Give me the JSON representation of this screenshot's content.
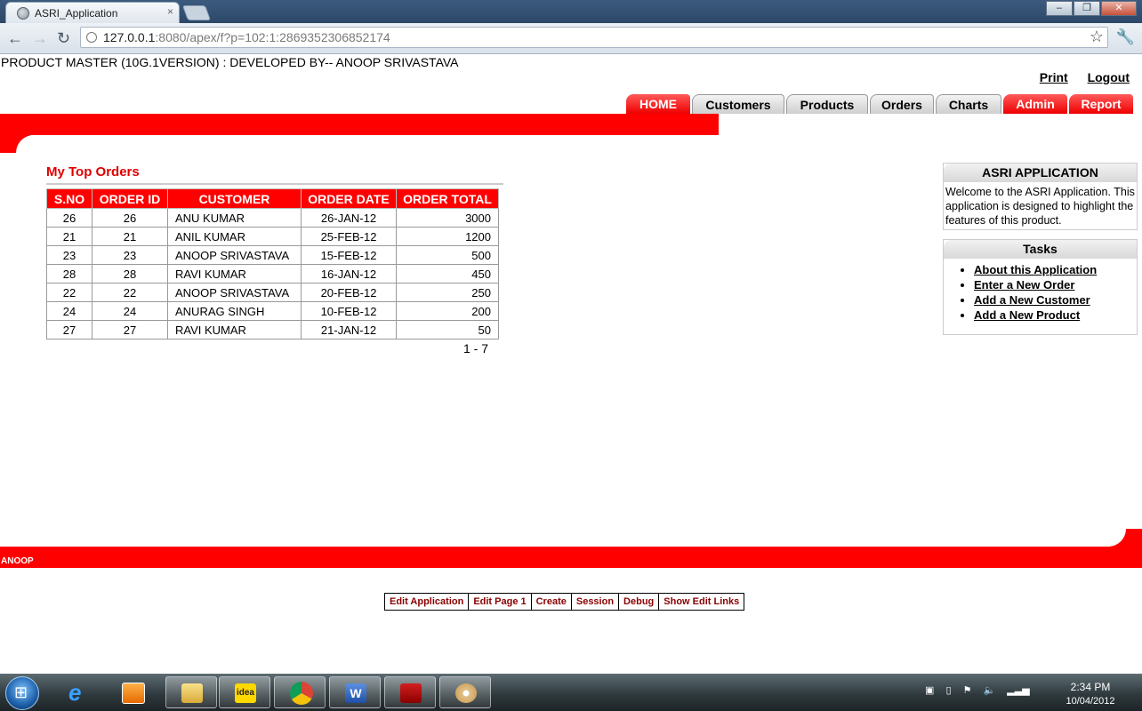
{
  "browser": {
    "tab_title": "ASRI_Application",
    "url_host": "127.0.0.1",
    "url_rest": ":8080/apex/f?p=102:1:2869352306852174"
  },
  "app": {
    "title": "PRODUCT MASTER (10G.1VERSION) : DEVELOPED BY-- ANOOP SRIVASTAVA",
    "links": [
      "Print",
      "Logout"
    ],
    "tabs": [
      {
        "label": "HOME",
        "style": "red"
      },
      {
        "label": "Customers",
        "style": "gray"
      },
      {
        "label": "Products",
        "style": "gray"
      },
      {
        "label": "Orders",
        "style": "gray"
      },
      {
        "label": "Charts",
        "style": "gray"
      },
      {
        "label": "Admin",
        "style": "red"
      },
      {
        "label": "Report",
        "style": "red"
      }
    ]
  },
  "orders_region": {
    "title": "My Top Orders",
    "columns": [
      "S.NO",
      "ORDER ID",
      "CUSTOMER",
      "ORDER DATE",
      "ORDER TOTAL"
    ],
    "rows": [
      [
        "26",
        "26",
        "ANU KUMAR",
        "26-JAN-12",
        "3000"
      ],
      [
        "21",
        "21",
        "ANIL KUMAR",
        "25-FEB-12",
        "1200"
      ],
      [
        "23",
        "23",
        "ANOOP SRIVASTAVA",
        "15-FEB-12",
        "500"
      ],
      [
        "28",
        "28",
        "RAVI KUMAR",
        "16-JAN-12",
        "450"
      ],
      [
        "22",
        "22",
        "ANOOP SRIVASTAVA",
        "20-FEB-12",
        "250"
      ],
      [
        "24",
        "24",
        "ANURAG SINGH",
        "10-FEB-12",
        "200"
      ],
      [
        "27",
        "27",
        "RAVI KUMAR",
        "21-JAN-12",
        "50"
      ]
    ],
    "pagination": "1 - 7"
  },
  "info_box": {
    "title": "ASRI APPLICATION",
    "text": "Welcome to the ASRI Application. This application is designed to highlight the features of this product."
  },
  "tasks_box": {
    "title": "Tasks",
    "items": [
      "About this Application",
      "Enter a New Order",
      "Add a New Customer",
      "Add a New Product"
    ]
  },
  "footer": {
    "user": "ANOOP",
    "dev_links": [
      "Edit Application",
      "Edit Page 1",
      "Create",
      "Session",
      "Debug",
      "Show Edit Links"
    ]
  },
  "taskbar": {
    "clock_time": "2:34 PM",
    "clock_date": "10/04/2012",
    "idea_label": "idea",
    "apps": [
      "start-orb",
      "internet-explorer-icon",
      "media-player-icon",
      "file-explorer-icon",
      "idea-netsetter-icon",
      "chrome-icon",
      "word-icon",
      "acrobat-icon",
      "paint-icon"
    ]
  }
}
